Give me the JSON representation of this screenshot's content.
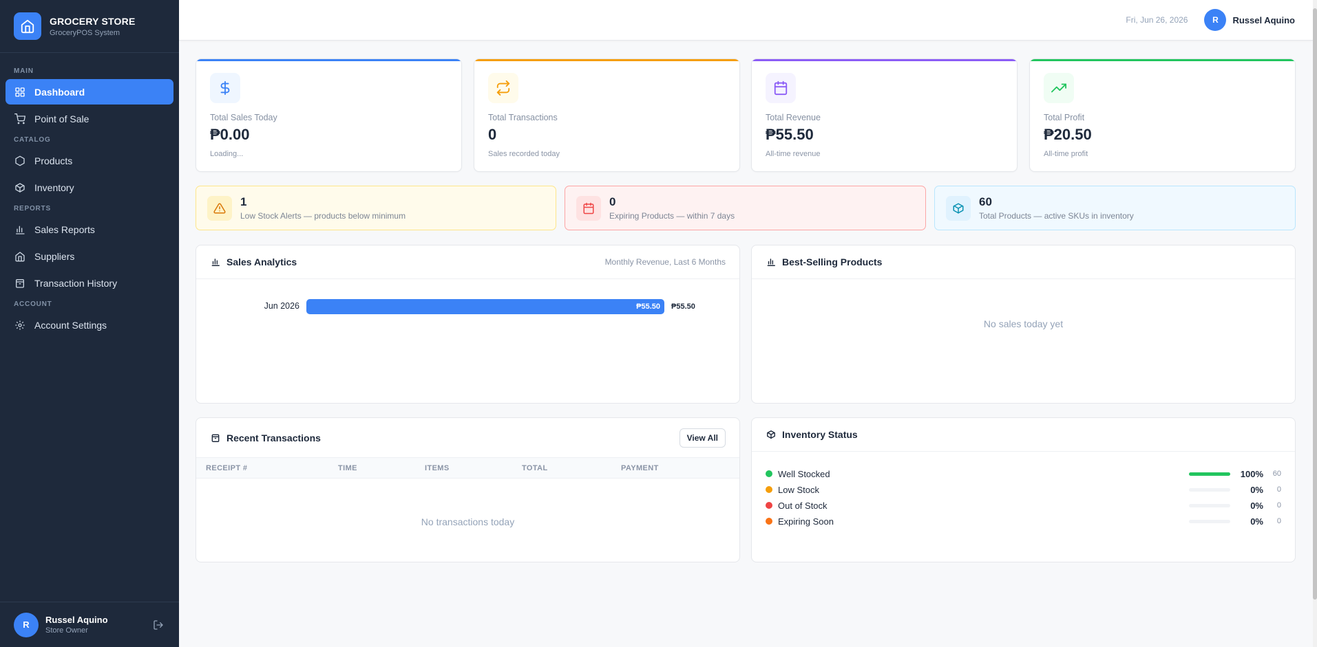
{
  "brand": {
    "title": "GROCERY STORE",
    "subtitle": "GroceryPOS System"
  },
  "nav": {
    "sections": [
      {
        "label": "MAIN",
        "items": [
          {
            "label": "Dashboard",
            "icon": "grid-icon",
            "active": true
          },
          {
            "label": "Point of Sale",
            "icon": "cart-icon"
          }
        ]
      },
      {
        "label": "CATALOG",
        "items": [
          {
            "label": "Products",
            "icon": "hexagon-icon"
          },
          {
            "label": "Inventory",
            "icon": "box-icon"
          }
        ]
      },
      {
        "label": "REPORTS",
        "items": [
          {
            "label": "Sales Reports",
            "icon": "bar-chart-icon"
          },
          {
            "label": "Suppliers",
            "icon": "store-icon"
          },
          {
            "label": "Transaction History",
            "icon": "archive-icon"
          }
        ]
      },
      {
        "label": "ACCOUNT",
        "items": [
          {
            "label": "Account Settings",
            "icon": "gear-icon"
          }
        ]
      }
    ]
  },
  "user": {
    "name": "Russel Aquino",
    "role": "Store Owner",
    "initial": "R"
  },
  "topbar": {
    "date": "Fri, Jun 26, 2026"
  },
  "stats": [
    {
      "label": "Total Sales Today",
      "value": "₱0.00",
      "note": "Loading...",
      "color": "#3b82f6",
      "icon": "dollar-icon"
    },
    {
      "label": "Total Transactions",
      "value": "0",
      "note": "Sales recorded today",
      "color": "#f59e0b",
      "icon": "repeat-icon"
    },
    {
      "label": "Total Revenue",
      "value": "₱55.50",
      "note": "All-time revenue",
      "color": "#8b5cf6",
      "icon": "calendar-icon"
    },
    {
      "label": "Total Profit",
      "value": "₱20.50",
      "note": "All-time profit",
      "color": "#22c55e",
      "icon": "trending-up-icon"
    }
  ],
  "alerts": [
    {
      "value": "1",
      "desc": "Low Stock Alerts — products below minimum",
      "icon": "warning-icon"
    },
    {
      "value": "0",
      "desc": "Expiring Products — within 7 days",
      "icon": "calendar-icon"
    },
    {
      "value": "60",
      "desc": "Total Products — active SKUs in inventory",
      "icon": "box-icon"
    }
  ],
  "analytics": {
    "title": "Sales Analytics",
    "meta": "Monthly Revenue, Last 6 Months",
    "rows": [
      {
        "label": "Jun 2026",
        "value": 55.5,
        "display": "₱55.50",
        "fraction": 1.0
      }
    ]
  },
  "best_selling": {
    "title": "Best-Selling Products",
    "empty": "No sales today yet"
  },
  "transactions": {
    "title": "Recent Transactions",
    "view_all": "View All",
    "columns": [
      "RECEIPT #",
      "TIME",
      "ITEMS",
      "TOTAL",
      "PAYMENT"
    ],
    "empty": "No transactions today"
  },
  "inventory": {
    "title": "Inventory Status",
    "rows": [
      {
        "label": "Well Stocked",
        "pct": "100%",
        "count": "60",
        "fraction": 1.0,
        "color": "#22c55e"
      },
      {
        "label": "Low Stock",
        "pct": "0%",
        "count": "0",
        "fraction": 0,
        "color": "#f59e0b"
      },
      {
        "label": "Out of Stock",
        "pct": "0%",
        "count": "0",
        "fraction": 0,
        "color": "#ef4444"
      },
      {
        "label": "Expiring Soon",
        "pct": "0%",
        "count": "0",
        "fraction": 0,
        "color": "#f97316"
      }
    ]
  }
}
